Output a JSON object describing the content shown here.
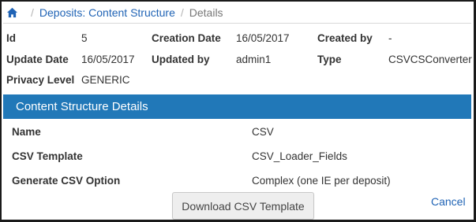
{
  "breadcrumb": {
    "home_icon": "home-icon",
    "items": [
      "Deposits: Content Structure",
      "Details"
    ],
    "separator": "/"
  },
  "metadata": {
    "id_label": "Id",
    "id_value": "5",
    "creation_date_label": "Creation Date",
    "creation_date_value": "16/05/2017",
    "created_by_label": "Created by",
    "created_by_value": "-",
    "update_date_label": "Update Date",
    "update_date_value": "16/05/2017",
    "updated_by_label": "Updated by",
    "updated_by_value": "admin1",
    "type_label": "Type",
    "type_value": "CSVCSConverter",
    "privacy_level_label": "Privacy Level",
    "privacy_level_value": "GENERIC"
  },
  "section": {
    "title": "Content Structure Details",
    "color": "#2178b8"
  },
  "details": {
    "name_label": "Name",
    "name_value": "CSV",
    "csv_template_label": "CSV Template",
    "csv_template_value": "CSV_Loader_Fields",
    "generate_option_label": "Generate CSV Option",
    "generate_option_value": "Complex (one IE per deposit)"
  },
  "actions": {
    "download_label": "Download CSV Template",
    "cancel_label": "Cancel"
  },
  "colors": {
    "link": "#1f63b5",
    "accent": "#2178b8"
  }
}
